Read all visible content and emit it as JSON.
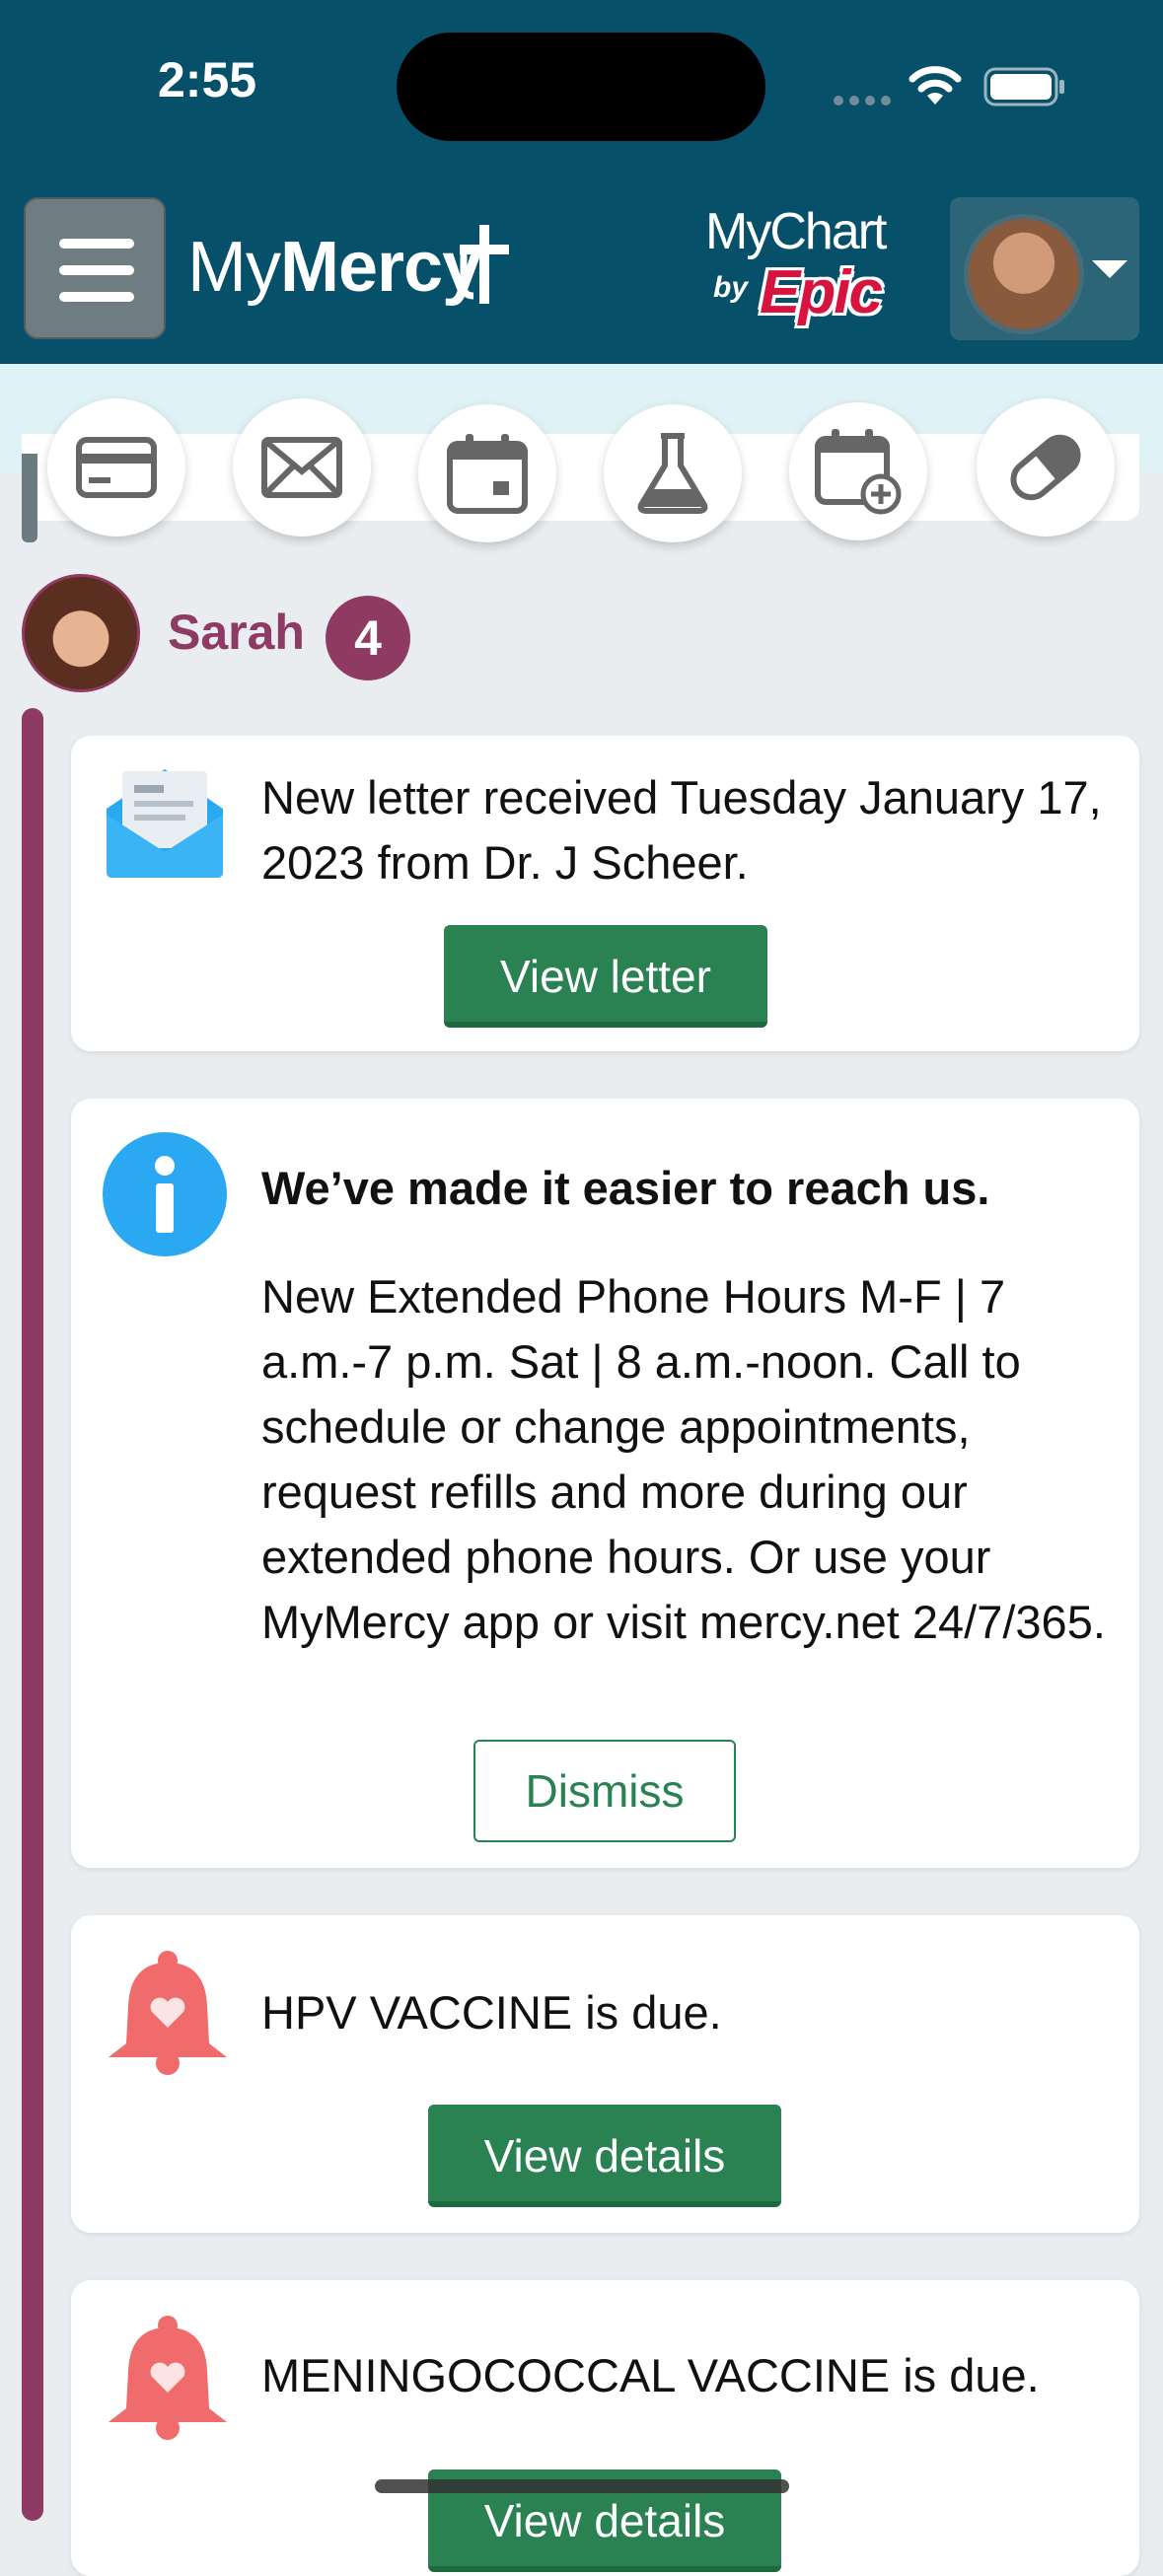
{
  "status_bar": {
    "time": "2:55"
  },
  "header": {
    "logo_light": "My",
    "logo_bold": "Mercy",
    "mychart_word": "MyChart",
    "by_word": "by",
    "epic_word": "Epic"
  },
  "quick_actions": [
    {
      "icon": "credit-card-icon",
      "label": "Billing"
    },
    {
      "icon": "envelope-icon",
      "label": "Messages"
    },
    {
      "icon": "calendar-icon",
      "label": "Visits"
    },
    {
      "icon": "flask-icon",
      "label": "Test Results"
    },
    {
      "icon": "calendar-add-icon",
      "label": "Schedule"
    },
    {
      "icon": "pill-icon",
      "label": "Medications"
    }
  ],
  "feed": {
    "person_name": "Sarah",
    "count": "4",
    "cards": [
      {
        "icon": "open-letter-icon",
        "text": "New letter received Tuesday January 17, 2023 from Dr. J Scheer.",
        "button": "View letter"
      },
      {
        "icon": "info-icon",
        "title": "We’ve made it easier to reach us.",
        "text": "New Extended Phone Hours M-F | 7 a.m.-7 p.m. Sat | 8 a.m.-noon.   Call to schedule or change appointments, request refills and more during our extended phone hours.  Or use your MyMercy app or visit mercy.net 24/7/365.",
        "button": "Dismiss"
      },
      {
        "icon": "bell-heart-icon",
        "text": "HPV VACCINE is due.",
        "button": "View details"
      },
      {
        "icon": "bell-heart-icon",
        "text": "MENINGOCOCCAL VACCINE is due.",
        "button": "View details"
      }
    ]
  },
  "colors": {
    "header": "#075069",
    "accent_purple": "#8e3a62",
    "button_green": "#2a8151",
    "info_blue": "#2aa9f2",
    "bell_red": "#f06b6b"
  }
}
